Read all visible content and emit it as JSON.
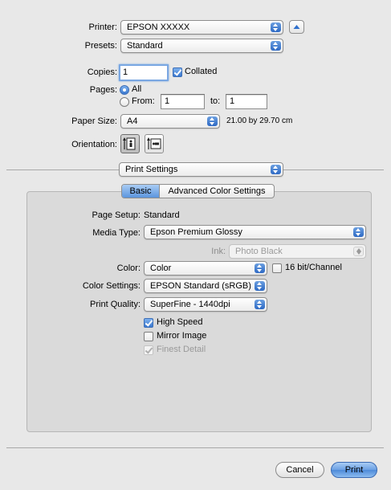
{
  "printer": {
    "label": "Printer:",
    "value": "EPSON XXXXX"
  },
  "presets": {
    "label": "Presets:",
    "value": "Standard"
  },
  "copies": {
    "label": "Copies:",
    "value": "1",
    "collated_label": "Collated",
    "collated": true
  },
  "pages": {
    "label": "Pages:",
    "all_label": "All",
    "from_label": "From:",
    "from_value": "1",
    "to_label": "to:",
    "to_value": "1",
    "selected": "All"
  },
  "paper_size": {
    "label": "Paper Size:",
    "value": "A4",
    "dimensions": "21.00 by 29.70 cm"
  },
  "orientation": {
    "label": "Orientation:",
    "selected": "portrait"
  },
  "section_popup": {
    "value": "Print Settings"
  },
  "tabs": [
    {
      "label": "Basic",
      "active": true
    },
    {
      "label": "Advanced Color Settings",
      "active": false
    }
  ],
  "basic": {
    "page_setup": {
      "label": "Page Setup:",
      "value": "Standard"
    },
    "media_type": {
      "label": "Media Type:",
      "value": "Epson Premium Glossy"
    },
    "ink": {
      "label": "Ink:",
      "value": "Photo Black"
    },
    "color": {
      "label": "Color:",
      "value": "Color",
      "bit16_label": "16 bit/Channel",
      "bit16": false
    },
    "color_settings": {
      "label": "Color Settings:",
      "value": "EPSON Standard (sRGB)"
    },
    "print_quality": {
      "label": "Print Quality:",
      "value": "SuperFine - 1440dpi"
    },
    "high_speed": {
      "label": "High Speed",
      "checked": true
    },
    "mirror_image": {
      "label": "Mirror Image",
      "checked": false
    },
    "finest_detail": {
      "label": "Finest Detail",
      "checked": true,
      "disabled": true
    }
  },
  "buttons": {
    "cancel": "Cancel",
    "print": "Print"
  },
  "colors": {
    "accent": "#4d8ad9",
    "window_bg": "#e8e8e8",
    "panel_bg": "#dadada"
  }
}
